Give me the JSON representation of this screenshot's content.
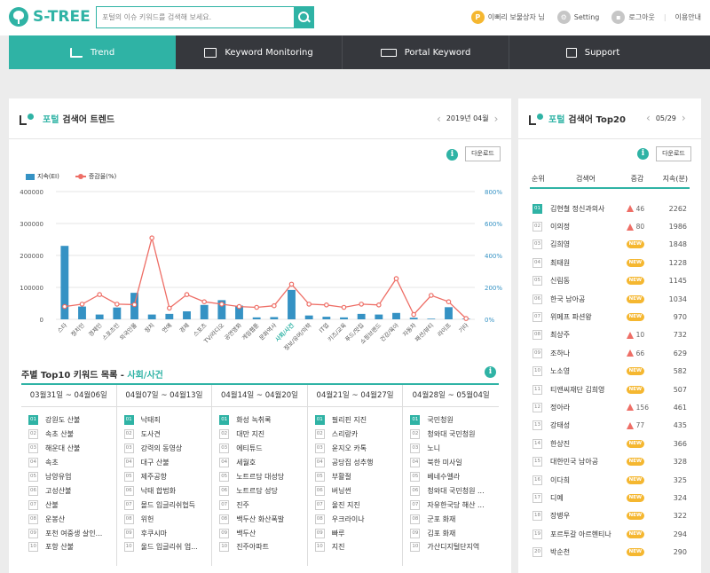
{
  "header": {
    "logo_text": "S-TREE",
    "search_placeholder": "포털의 이슈 키워드를 검색해 보세요.",
    "user_badge": "P",
    "user_name": "이뻐리 보물상자 님",
    "setting": "Setting",
    "logout": "로그아웃",
    "guide": "이용안내"
  },
  "nav": {
    "items": [
      {
        "label": "Trend",
        "icon": "chart-icon",
        "active": true
      },
      {
        "label": "Keyword Monitoring",
        "icon": "monitor-icon",
        "active": false
      },
      {
        "label": "Portal Keyword",
        "icon": "keyboard-icon",
        "active": false
      },
      {
        "label": "Support",
        "icon": "megaphone-icon",
        "active": false
      }
    ]
  },
  "trend_panel": {
    "title_accent": "포털",
    "title_rest": "검색어 트렌드",
    "date": "2019년 04월",
    "download": "다운로드",
    "info": "i",
    "legend_bar": "지속(EI)",
    "legend_line": "증감율(%)"
  },
  "chart_data": {
    "type": "bar",
    "categories": [
      "스타",
      "정치인",
      "경제인",
      "스포츠인",
      "외국인물",
      "정치",
      "연예",
      "경제",
      "스포츠",
      "TV/라디오",
      "공연영화",
      "게임웹툰",
      "문화역사",
      "사회/사건",
      "정보/유머/의학",
      "IT업",
      "키즈/교육",
      "푸드/맛집",
      "쇼핑브랜드",
      "건강/육아",
      "자동차",
      "패션/뷰티",
      "라이프",
      "기타"
    ],
    "highlight_category": "사회/사건",
    "series": [
      {
        "name": "지속(EI)",
        "axis": "left",
        "values": [
          230000,
          40000,
          15000,
          37000,
          83000,
          15000,
          17000,
          25000,
          45000,
          60000,
          43000,
          6000,
          7000,
          92000,
          12000,
          8000,
          6000,
          17000,
          15000,
          20000,
          5000,
          2000,
          38000,
          2000
        ]
      },
      {
        "name": "증감율(%)",
        "axis": "right",
        "values": [
          80,
          95,
          155,
          95,
          92,
          510,
          70,
          155,
          110,
          95,
          80,
          75,
          85,
          220,
          95,
          90,
          75,
          95,
          90,
          255,
          30,
          150,
          110,
          5
        ]
      }
    ],
    "y_left_ticks": [
      "0",
      "100000",
      "200000",
      "300000",
      "400000"
    ],
    "ylim_left": [
      0,
      400000
    ],
    "y_right_ticks": [
      "0%",
      "200%",
      "400%",
      "600%",
      "800%"
    ],
    "ylim_right": [
      0,
      800
    ],
    "colors": {
      "bar": "#3592c4",
      "line": "#ee6e66",
      "highlight_label": "#2fb3a5"
    },
    "grid": true,
    "legend_position": "top-left"
  },
  "weekly": {
    "title": "주별 Top10 키워드 목록 - ",
    "category": "사회/사건",
    "weeks": [
      {
        "label": "03월31일 ~ 04월06일",
        "items": [
          "강원도 산불",
          "속초 산불",
          "해운대 산불",
          "속초",
          "남양유업",
          "고성산불",
          "산불",
          "운봉산",
          "포천 여중생 살인...",
          "포항 산불"
        ]
      },
      {
        "label": "04월07일 ~ 04월13일",
        "items": [
          "낙태죄",
          "도사견",
          "강력의 동영상",
          "대구 산불",
          "제주공항",
          "낙태 합법화",
          "몰드 입글리쉬협득",
          "위헌",
          "후쿠시마",
          "울드 입글리쉬 업..."
        ]
      },
      {
        "label": "04월14일 ~ 04월20일",
        "items": [
          "화성 녹취록",
          "대만 지진",
          "에티튜드",
          "세월호",
          "노트르담 대성당",
          "노트르담 성당",
          "진주",
          "백두산 화산폭발",
          "백두산",
          "진주아파트"
        ]
      },
      {
        "label": "04월21일 ~ 04월27일",
        "items": [
          "필리핀 지진",
          "스리랑카",
          "윤지오 카톡",
          "공당집 성추행",
          "부활절",
          "버닝썬",
          "울진 지진",
          "우크라이나",
          "빠루",
          "지진"
        ]
      },
      {
        "label": "04월28일 ~ 05월04일",
        "items": [
          "국민청원",
          "청와대 국민청원",
          "노니",
          "북한 미사일",
          "베네수엘라",
          "청와대 국민청원 ...",
          "자유한국당 해산 ...",
          "군포 화재",
          "김포 화재",
          "가산디지털단지역"
        ]
      }
    ],
    "rank_labels": [
      "01",
      "02",
      "03",
      "04",
      "05",
      "06",
      "07",
      "08",
      "09",
      "10"
    ]
  },
  "top20_panel": {
    "title_accent": "포털",
    "title_rest": "검색어 Top20",
    "date": "05/29",
    "download": "다운로드",
    "info": "i",
    "headers": {
      "rank": "순위",
      "keyword": "검색어",
      "change": "증감",
      "index": "지속(분)"
    },
    "new_label": "NEW",
    "rows": [
      {
        "rank": "01",
        "keyword": "김현철 정신과의사",
        "change": "46",
        "is_new": false,
        "index": "2262"
      },
      {
        "rank": "02",
        "keyword": "이의정",
        "change": "80",
        "is_new": false,
        "index": "1986"
      },
      {
        "rank": "03",
        "keyword": "김희영",
        "change": "",
        "is_new": true,
        "index": "1848"
      },
      {
        "rank": "04",
        "keyword": "최태원",
        "change": "",
        "is_new": true,
        "index": "1228"
      },
      {
        "rank": "05",
        "keyword": "신림동",
        "change": "",
        "is_new": true,
        "index": "1145"
      },
      {
        "rank": "06",
        "keyword": "한국 남아공",
        "change": "",
        "is_new": true,
        "index": "1034"
      },
      {
        "rank": "07",
        "keyword": "위메프 파션왕",
        "change": "",
        "is_new": true,
        "index": "970"
      },
      {
        "rank": "08",
        "keyword": "최상주",
        "change": "10",
        "is_new": false,
        "index": "732"
      },
      {
        "rank": "09",
        "keyword": "조하나",
        "change": "66",
        "is_new": false,
        "index": "629"
      },
      {
        "rank": "10",
        "keyword": "노소영",
        "change": "",
        "is_new": true,
        "index": "582"
      },
      {
        "rank": "11",
        "keyword": "티앤씨재단 김희영",
        "change": "",
        "is_new": true,
        "index": "507"
      },
      {
        "rank": "12",
        "keyword": "정아라",
        "change": "156",
        "is_new": false,
        "index": "461"
      },
      {
        "rank": "13",
        "keyword": "강태성",
        "change": "77",
        "is_new": false,
        "index": "435"
      },
      {
        "rank": "14",
        "keyword": "한상진",
        "change": "",
        "is_new": true,
        "index": "366"
      },
      {
        "rank": "15",
        "keyword": "대한민국 남아공",
        "change": "",
        "is_new": true,
        "index": "328"
      },
      {
        "rank": "16",
        "keyword": "이다희",
        "change": "",
        "is_new": true,
        "index": "325"
      },
      {
        "rank": "17",
        "keyword": "디예",
        "change": "",
        "is_new": true,
        "index": "324"
      },
      {
        "rank": "18",
        "keyword": "장병우",
        "change": "",
        "is_new": true,
        "index": "322"
      },
      {
        "rank": "19",
        "keyword": "포르투갈 아르헨티나",
        "change": "",
        "is_new": true,
        "index": "294"
      },
      {
        "rank": "20",
        "keyword": "박순천",
        "change": "",
        "is_new": true,
        "index": "290"
      }
    ]
  }
}
